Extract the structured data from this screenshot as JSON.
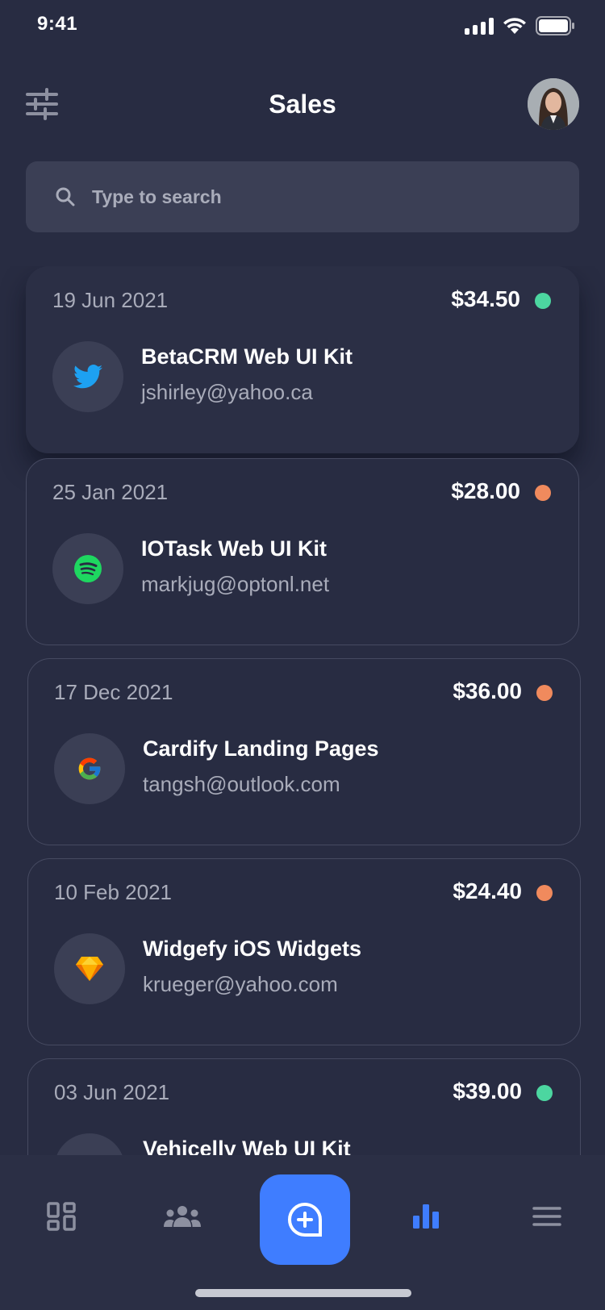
{
  "status_bar": {
    "time": "9:41"
  },
  "header": {
    "title": "Sales"
  },
  "search": {
    "placeholder": "Type to search"
  },
  "sales": [
    {
      "date": "19 Jun 2021",
      "amount": "$34.50",
      "status_color": "#4CD6A0",
      "product": "BetaCRM Web UI Kit",
      "email": "jshirley@yahoo.ca",
      "logo": "twitter-logo"
    },
    {
      "date": "25 Jan 2021",
      "amount": "$28.00",
      "status_color": "#F08A5D",
      "product": "IOTask Web UI Kit",
      "email": "markjug@optonl.net",
      "logo": "spotify-logo"
    },
    {
      "date": "17 Dec 2021",
      "amount": "$36.00",
      "status_color": "#F08A5D",
      "product": "Cardify Landing Pages",
      "email": "tangsh@outlook.com",
      "logo": "google-logo"
    },
    {
      "date": "10 Feb 2021",
      "amount": "$24.40",
      "status_color": "#F08A5D",
      "product": "Widgefy iOS Widgets",
      "email": "krueger@yahoo.com",
      "logo": "sketch-logo"
    },
    {
      "date": "03 Jun 2021",
      "amount": "$39.00",
      "status_color": "#4CD6A0",
      "product": "Vehicelly Web UI Kit",
      "email": "",
      "logo": "logo"
    }
  ],
  "bottom_nav": {
    "items": [
      "dashboard-icon",
      "users-icon",
      "add-icon",
      "chart-icon",
      "menu-icon"
    ],
    "active": "chart-icon",
    "accent": "#3F7DFF"
  }
}
